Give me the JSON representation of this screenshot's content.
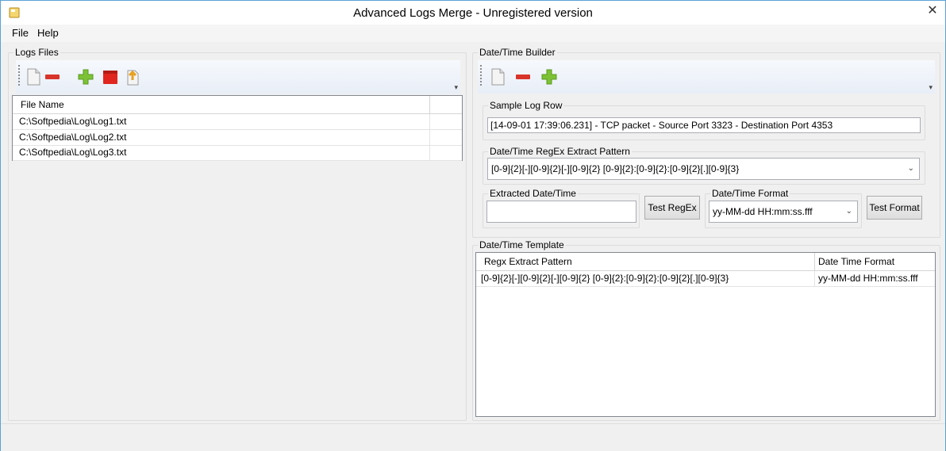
{
  "window": {
    "title": "Advanced Logs Merge - Unregistered version",
    "close_glyph": "✕"
  },
  "menu": [
    {
      "label": "File"
    },
    {
      "label": "Help"
    }
  ],
  "logs_files": {
    "title": "Logs Files",
    "toolbar": [
      "new-file-icon",
      "remove-icon",
      "add-icon",
      "delete-icon",
      "upload-file-icon"
    ],
    "columns": [
      "File Name",
      ""
    ],
    "rows": [
      [
        "C:\\Softpedia\\Log\\Log1.txt",
        ""
      ],
      [
        "C:\\Softpedia\\Log\\Log2.txt",
        ""
      ],
      [
        "C:\\Softpedia\\Log\\Log3.txt",
        ""
      ]
    ]
  },
  "builder": {
    "title": "Date/Time Builder",
    "toolbar": [
      "new-file-icon",
      "remove-icon",
      "add-icon"
    ],
    "sample_log_row": {
      "label": "Sample Log Row",
      "value": "[14-09-01 17:39:06.231] - TCP packet - Source Port 3323 - Destination Port 4353"
    },
    "regex_pattern": {
      "label": "Date/Time RegEx Extract Pattern",
      "value": "[0-9]{2}[-][0-9]{2}[-][0-9]{2} [0-9]{2}:[0-9]{2}:[0-9]{2}[.][0-9]{3}"
    },
    "extracted": {
      "label": "Extracted Date/Time",
      "value": ""
    },
    "test_regex_label": "Test RegEx",
    "format": {
      "label": "Date/Time Format",
      "value": "yy-MM-dd HH:mm:ss.fff"
    },
    "test_format_label": "Test Format"
  },
  "template": {
    "title": "Date/Time Template",
    "columns": [
      "Regx Extract Pattern",
      "Date Time Format"
    ],
    "rows": [
      [
        "[0-9]{2}[-][0-9]{2}[-][0-9]{2} [0-9]{2}:[0-9]{2}:[0-9]{2}[.][0-9]{3}",
        "yy-MM-dd HH:mm:ss.fff"
      ]
    ]
  },
  "colors": {
    "accent_border": "#5aa2d6",
    "toolbar_bg": "#e8eef7",
    "remove_red": "#d9342b",
    "add_green": "#7cc234"
  }
}
